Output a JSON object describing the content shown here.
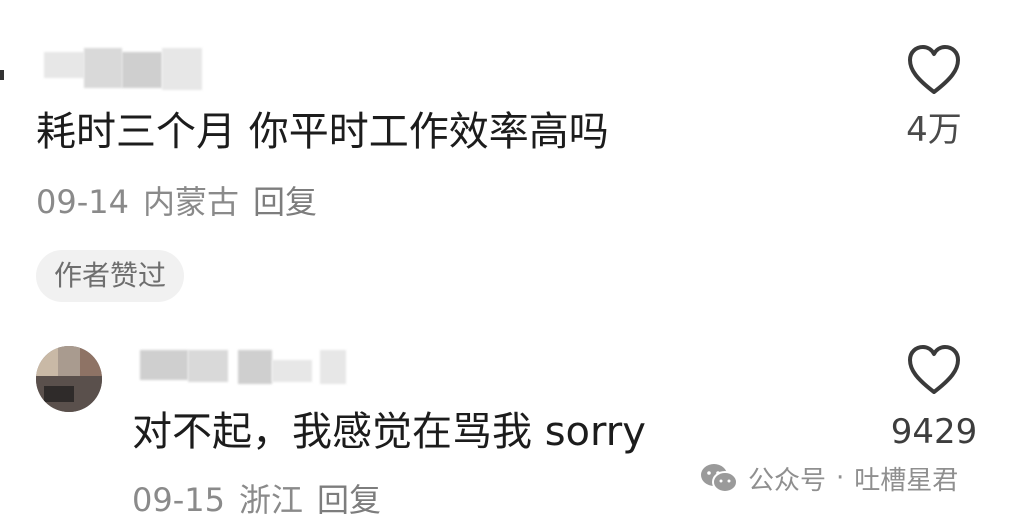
{
  "comments": [
    {
      "text": "耗时三个月 你平时工作效率高吗",
      "date": "09-14",
      "location": "内蒙古",
      "reply_label": "回复",
      "badge": "作者赞过",
      "like_icon": "heart-outline-icon",
      "likes": "4万"
    },
    {
      "text": "对不起，我感觉在骂我 sorry",
      "date": "09-15",
      "location": "浙江",
      "reply_label": "回复",
      "like_icon": "heart-outline-icon",
      "likes": "9429"
    }
  ],
  "watermark": {
    "icon": "wechat-icon",
    "source": "公众号",
    "separator": "·",
    "account": "吐槽星君"
  },
  "colors": {
    "text_primary": "#1c1c1c",
    "text_meta": "#8a8a8a",
    "badge_bg": "#f1f1f1",
    "background": "#ffffff"
  }
}
